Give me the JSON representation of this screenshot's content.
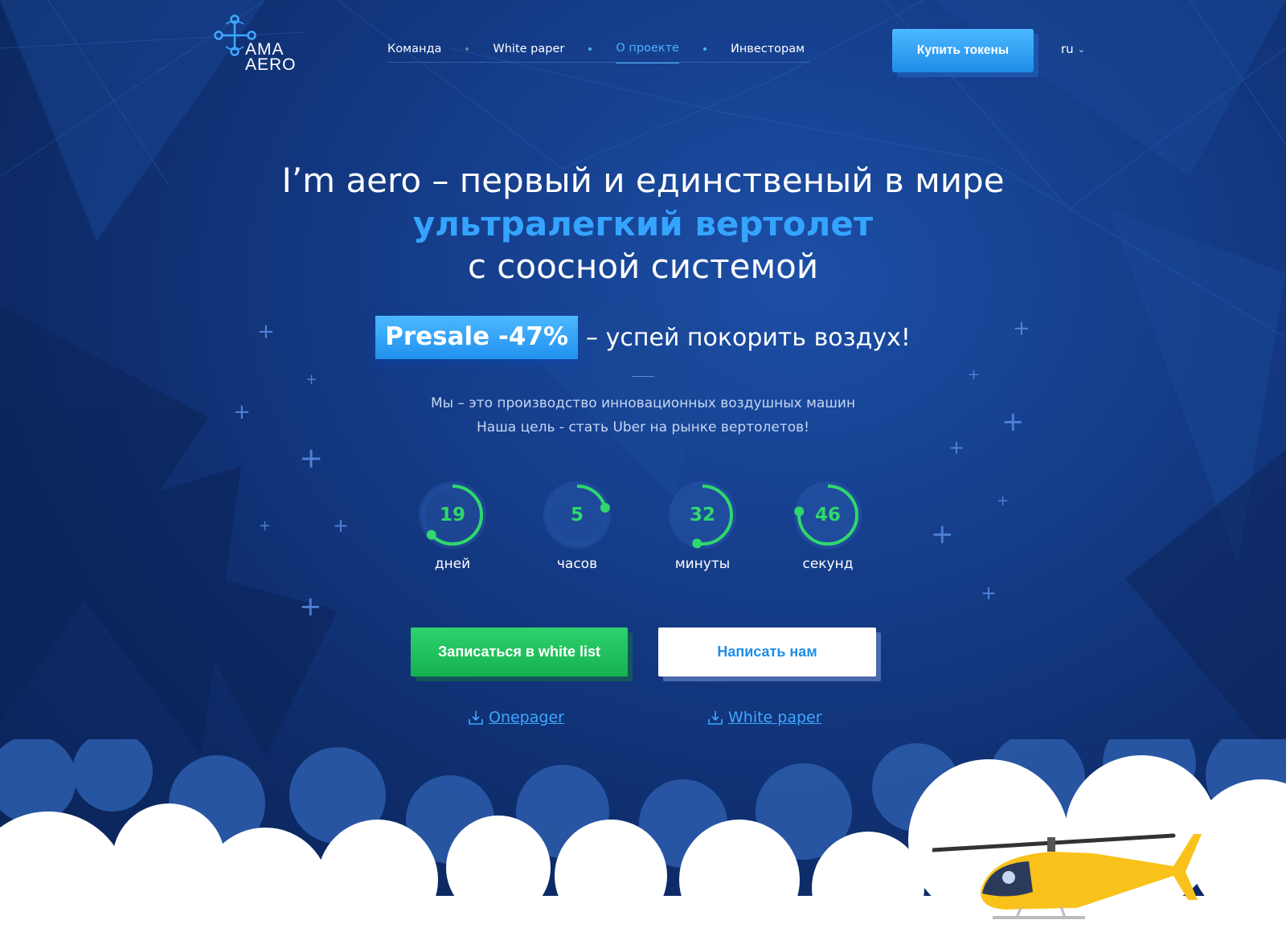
{
  "brand": {
    "logo_line1": "AMA",
    "logo_line2": "AERO"
  },
  "nav": {
    "items": [
      {
        "label": "Команда"
      },
      {
        "label": "White paper"
      },
      {
        "label": "О проекте"
      },
      {
        "label": "Инвесторам"
      }
    ],
    "active_index": 2,
    "buy_button": "Купить токены",
    "lang": "ru"
  },
  "hero": {
    "line1": "I’m aero – первый и единственый в мире",
    "line2": "ультралегкий вертолет",
    "line3": "с соосной системой",
    "presale_badge": "Presale -47%",
    "presale_text": "– успей покорить воздух!",
    "desc1": "Мы – это производство инновационных воздушных машин",
    "desc2": "Наша цель - стать Uber на рынке вертолетов!"
  },
  "countdown": [
    {
      "value": "19",
      "label": "дней",
      "fraction": 0.63
    },
    {
      "value": "5",
      "label": "часов",
      "fraction": 0.21
    },
    {
      "value": "32",
      "label": "минуты",
      "fraction": 0.53
    },
    {
      "value": "46",
      "label": "секунд",
      "fraction": 0.77
    }
  ],
  "actions": {
    "whitelist": "Записаться в white list",
    "write": "Написать нам",
    "onepager": "Onepager",
    "whitepaper": "White paper"
  },
  "colors": {
    "accent_blue": "#35a4ff",
    "green": "#2fd86b",
    "bg_dark": "#0d2a66",
    "heli_yellow": "#f9c21b"
  },
  "icons": [
    "logo-drone-icon",
    "chevron-down-icon",
    "download-icon",
    "plus-decor-icon",
    "helicopter-illustration"
  ]
}
